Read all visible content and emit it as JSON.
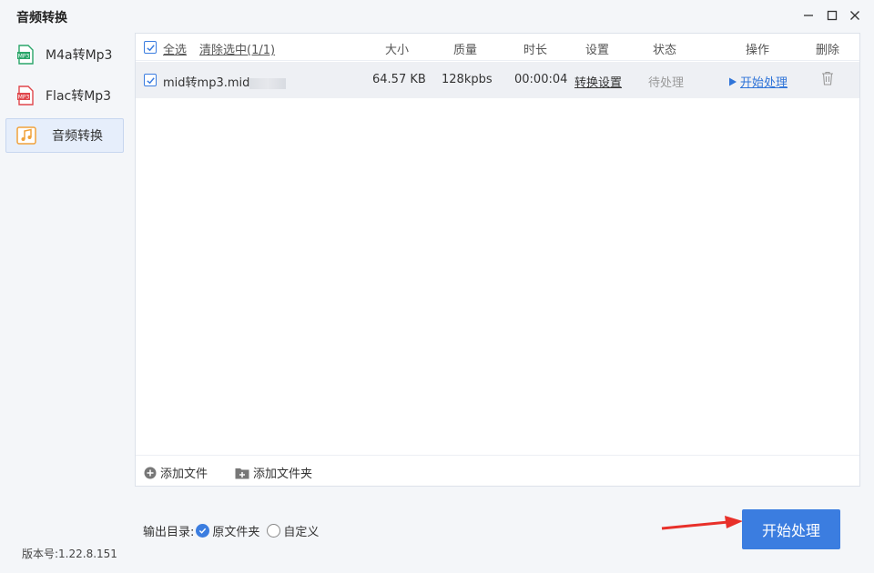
{
  "window": {
    "title": "音频转换",
    "controls": {
      "minimize": "—",
      "maximize": "☐",
      "close": "✕"
    }
  },
  "sidebar": {
    "items": [
      {
        "label": "M4a转Mp3",
        "icon": "m4a-file-icon",
        "icon_text": "MP3",
        "icon_color": "#2aa66a"
      },
      {
        "label": "Flac转Mp3",
        "icon": "flac-file-icon",
        "icon_text": "MP3",
        "icon_color": "#e0474c"
      },
      {
        "label": "音频转换",
        "icon": "music-note-icon",
        "icon_color": "#f0a23b",
        "active": true
      }
    ],
    "version": "版本号:1.22.8.151"
  },
  "table": {
    "select_all": "全选",
    "clear_selected": "清除选中(1/1)",
    "columns": [
      "大小",
      "质量",
      "时长",
      "设置",
      "状态",
      "操作",
      "删除"
    ],
    "rows": [
      {
        "checked": true,
        "name": "mid转mp3.mid",
        "size": "64.57 KB",
        "quality": "128kpbs",
        "duration": "00:00:04",
        "settings": "转换设置",
        "status": "待处理",
        "action": "开始处理"
      }
    ]
  },
  "bottom": {
    "add_file": "添加文件",
    "add_folder": "添加文件夹"
  },
  "output": {
    "label": "输出目录:",
    "option_original": "原文件夹",
    "option_custom": "自定义",
    "selected": "原文件夹"
  },
  "start_button": "开始处理",
  "colors": {
    "accent": "#3b7de0",
    "arrow": "#e8302a",
    "row_bg": "#eef0f4"
  }
}
